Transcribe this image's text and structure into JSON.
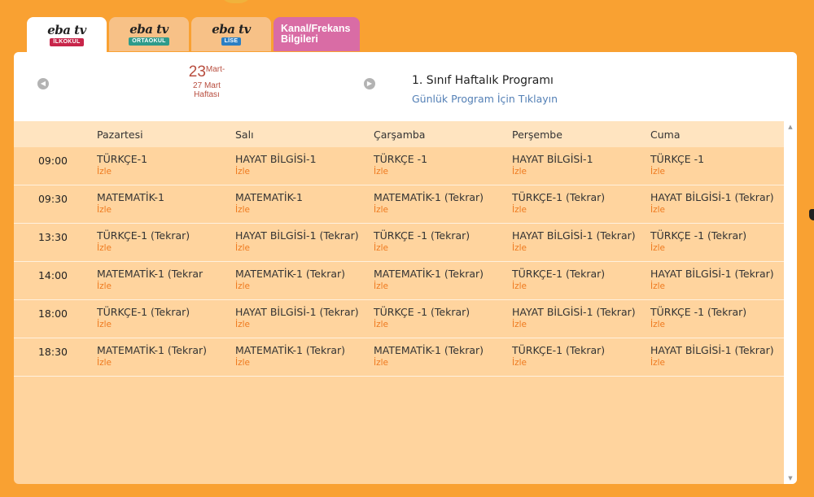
{
  "tabs": [
    {
      "logo": "eba tv",
      "badge": "İLKOKUL",
      "badge_color": "#c8254a",
      "active": true
    },
    {
      "logo": "eba tv",
      "badge": "ORTAOKUL",
      "badge_color": "#2e9b8b",
      "active": false
    },
    {
      "logo": "eba tv",
      "badge": "LİSE",
      "badge_color": "#2a7fc4",
      "active": false
    }
  ],
  "kanal_tab": {
    "line1": "Kanal/Frekans",
    "line2": "Bilgileri"
  },
  "week": {
    "day": "23",
    "r1": "Mart-",
    "r2": "27 Mart",
    "r3": "Haftası"
  },
  "program": {
    "title": "1. Sınıf Haftalık Programı",
    "link": "Günlük Program İçin Tıklayın"
  },
  "days": [
    "Pazartesi",
    "Salı",
    "Çarşamba",
    "Perşembe",
    "Cuma"
  ],
  "watch_label": "İzle",
  "rows": [
    {
      "time": "09:00",
      "cells": [
        "TÜRKÇE-1",
        "HAYAT BİLGİSİ-1",
        "TÜRKÇE -1",
        "HAYAT BİLGİSİ-1",
        "TÜRKÇE -1"
      ]
    },
    {
      "time": "09:30",
      "cells": [
        "MATEMATİK-1",
        "MATEMATİK-1",
        "MATEMATİK-1 (Tekrar)",
        "TÜRKÇE-1 (Tekrar)",
        "HAYAT BİLGİSİ-1 (Tekrar)"
      ]
    },
    {
      "time": "13:30",
      "cells": [
        "TÜRKÇE-1 (Tekrar)",
        "HAYAT BİLGİSİ-1 (Tekrar)",
        "TÜRKÇE -1 (Tekrar)",
        "HAYAT BİLGİSİ-1 (Tekrar)",
        "TÜRKÇE -1 (Tekrar)"
      ]
    },
    {
      "time": "14:00",
      "cells": [
        "MATEMATİK-1 (Tekrar",
        "MATEMATİK-1 (Tekrar)",
        "MATEMATİK-1 (Tekrar)",
        "TÜRKÇE-1 (Tekrar)",
        "HAYAT BİLGİSİ-1 (Tekrar)"
      ]
    },
    {
      "time": "18:00",
      "cells": [
        "TÜRKÇE-1 (Tekrar)",
        "HAYAT BİLGİSİ-1 (Tekrar)",
        "TÜRKÇE -1 (Tekrar)",
        "HAYAT BİLGİSİ-1 (Tekrar)",
        "TÜRKÇE -1 (Tekrar)"
      ]
    },
    {
      "time": "18:30",
      "cells": [
        "MATEMATİK-1 (Tekrar)",
        "MATEMATİK-1 (Tekrar)",
        "MATEMATİK-1 (Tekrar)",
        "TÜRKÇE-1 (Tekrar)",
        "HAYAT BİLGİSİ-1 (Tekrar)"
      ]
    }
  ],
  "icons": {
    "prev": "chevron-left-icon",
    "next": "chevron-right-icon",
    "scroll_up": "arrow-up-icon",
    "scroll_down": "arrow-down-icon"
  }
}
